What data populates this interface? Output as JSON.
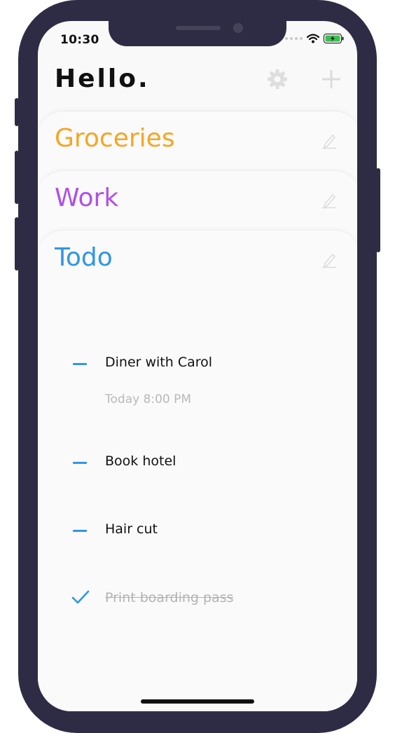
{
  "status_bar": {
    "time": "10:30",
    "battery_icon": "battery-charging-icon",
    "wifi_icon": "wifi-icon"
  },
  "header": {
    "greeting": "Hello.",
    "settings_icon": "gear-icon",
    "add_icon": "plus-icon"
  },
  "colors": {
    "groceries": "#f5a623",
    "work": "#b150e6",
    "todo": "#2f96e8",
    "device_frame": "#2e2c45"
  },
  "lists": [
    {
      "title": "Groceries"
    },
    {
      "title": "Work"
    },
    {
      "title": "Todo"
    }
  ],
  "todo_items": [
    {
      "text": "Diner with Carol",
      "subtext": "Today 8:00 PM",
      "done": false
    },
    {
      "text": "Book hotel",
      "done": false
    },
    {
      "text": "Hair cut",
      "done": false
    },
    {
      "text": "Print boarding pass",
      "done": true
    }
  ]
}
